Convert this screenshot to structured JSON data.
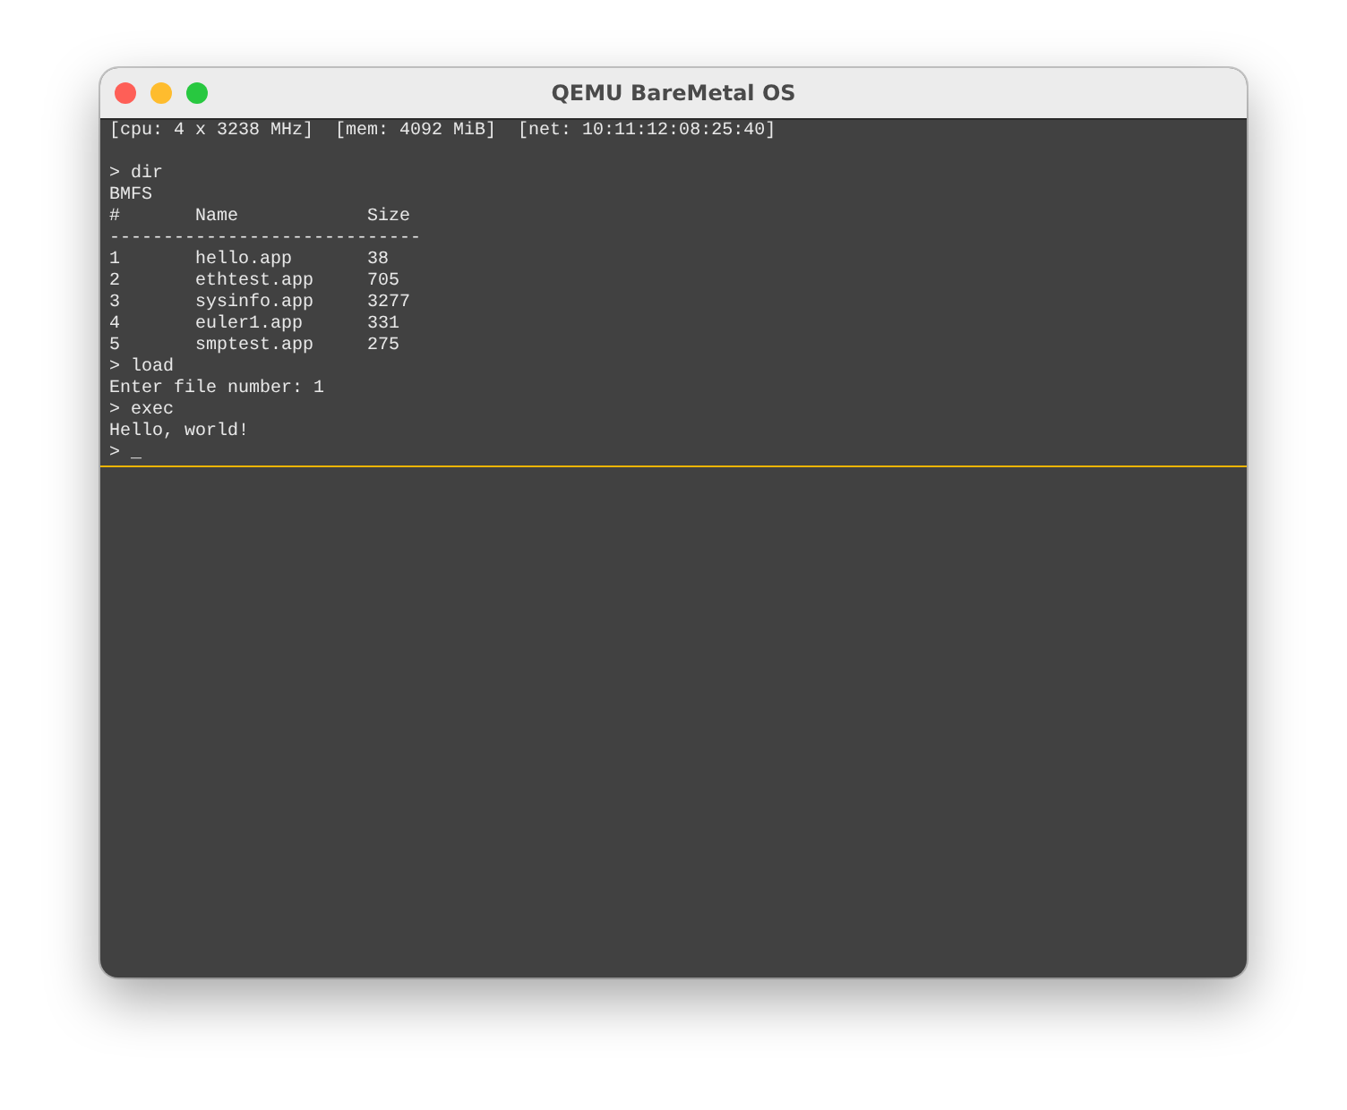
{
  "window": {
    "title": "QEMU BareMetal OS"
  },
  "status_line": [
    "[cpu: 4 x 3238 MHz]",
    "[mem: 4092 MiB]",
    "[net: 10:11:12:08:25:40]"
  ],
  "commands_before": [
    "> dir",
    "BMFS"
  ],
  "table": {
    "columns": [
      "#",
      "Name",
      "Size"
    ],
    "rule": "-----------------------------",
    "rows": [
      [
        "1",
        "hello.app",
        "38"
      ],
      [
        "2",
        "ethtest.app",
        "705"
      ],
      [
        "3",
        "sysinfo.app",
        "3277"
      ],
      [
        "4",
        "euler1.app",
        "331"
      ],
      [
        "5",
        "smptest.app",
        "275"
      ]
    ]
  },
  "commands_after": [
    "> load",
    "Enter file number: 1",
    "> exec",
    "Hello, world!",
    "> _"
  ]
}
